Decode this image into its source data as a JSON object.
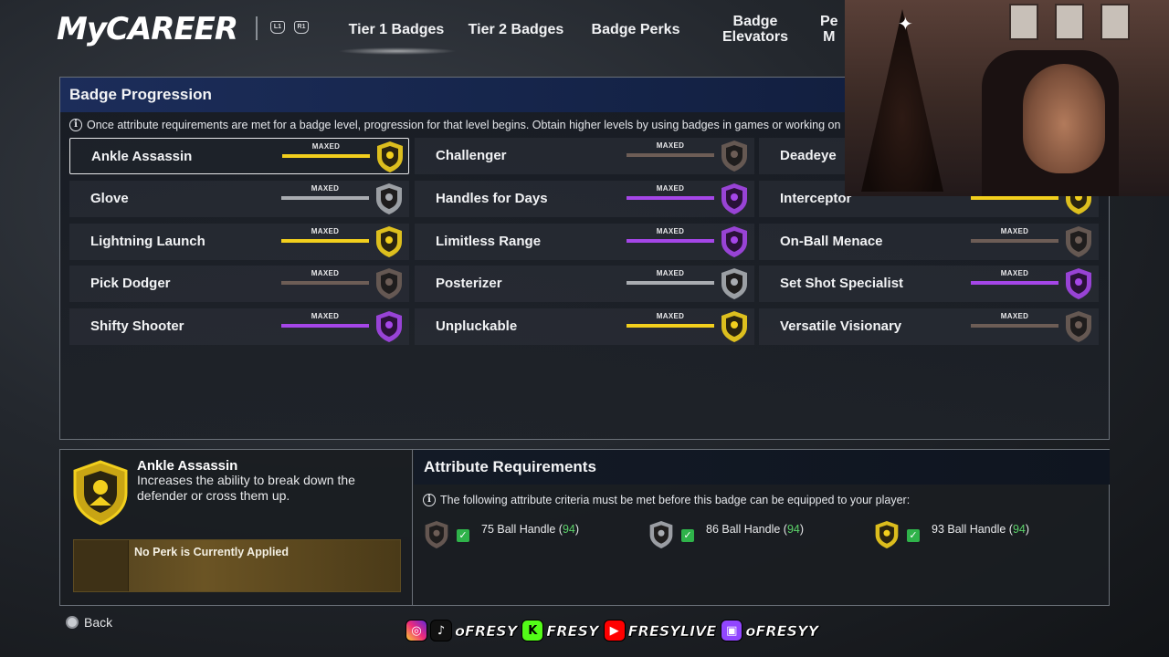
{
  "nav": {
    "logo": "MyCAREER",
    "bumper_left": "L1",
    "bumper_right": "R1",
    "tabs": [
      {
        "label": "Tier 1 Badges"
      },
      {
        "label": "Tier 2 Badges"
      },
      {
        "label": "Badge Perks"
      },
      {
        "label": "Badge\nElevators"
      },
      {
        "label": "Pe\nM"
      }
    ]
  },
  "progression": {
    "title": "Badge Progression",
    "info": "Once attribute requirements are met for a badge level, progression for that level begins. Obtain higher levels by using badges in games or working on",
    "status_label": "MAXED",
    "badges": [
      {
        "name": "Ankle Assassin",
        "tier": "gold",
        "progress": 1.0,
        "selected": true
      },
      {
        "name": "Challenger",
        "tier": "bronze",
        "progress": 1.0
      },
      {
        "name": "Deadeye",
        "tier": "gold",
        "progress": 1.0
      },
      {
        "name": "Glove",
        "tier": "silver",
        "progress": 1.0
      },
      {
        "name": "Handles for Days",
        "tier": "purple",
        "progress": 1.0
      },
      {
        "name": "Interceptor",
        "tier": "gold",
        "progress": 1.0
      },
      {
        "name": "Lightning Launch",
        "tier": "gold",
        "progress": 1.0
      },
      {
        "name": "Limitless Range",
        "tier": "purple",
        "progress": 1.0
      },
      {
        "name": "On-Ball Menace",
        "tier": "bronze",
        "progress": 1.0
      },
      {
        "name": "Pick Dodger",
        "tier": "bronze",
        "progress": 1.0
      },
      {
        "name": "Posterizer",
        "tier": "silver",
        "progress": 1.0
      },
      {
        "name": "Set Shot Specialist",
        "tier": "purple",
        "progress": 1.0
      },
      {
        "name": "Shifty Shooter",
        "tier": "purple",
        "progress": 1.0
      },
      {
        "name": "Unpluckable",
        "tier": "gold",
        "progress": 1.0
      },
      {
        "name": "Versatile Visionary",
        "tier": "bronze",
        "progress": 1.0
      }
    ],
    "colors": {
      "gold": "#f2cf1d",
      "purple": "#a546e8",
      "silver": "#a9acb1",
      "bronze": "#6d5d56"
    }
  },
  "details": {
    "badge_name": "Ankle Assassin",
    "description": "Increases the ability to break down the defender or cross them up.",
    "perk": "No Perk is Currently Applied"
  },
  "requirements": {
    "title": "Attribute Requirements",
    "info": "The following attribute criteria must be met before this badge can be equipped to your player:",
    "items": [
      {
        "level": "bronze",
        "required": "75",
        "attribute": "Ball Handle",
        "current": "94"
      },
      {
        "level": "silver",
        "required": "86",
        "attribute": "Ball Handle",
        "current": "94"
      },
      {
        "level": "gold",
        "required": "93",
        "attribute": "Ball Handle",
        "current": "94"
      }
    ]
  },
  "footer": {
    "back_label": "Back",
    "socials": [
      {
        "icon": "instagram-icon"
      },
      {
        "icon": "tiktok-icon",
        "handle": "oFRESY"
      },
      {
        "icon": "kick-icon",
        "handle": "FRESY"
      },
      {
        "icon": "youtube-icon",
        "handle": "FRESYLIVE"
      },
      {
        "icon": "twitch-icon",
        "handle": "oFRESYY"
      }
    ]
  }
}
